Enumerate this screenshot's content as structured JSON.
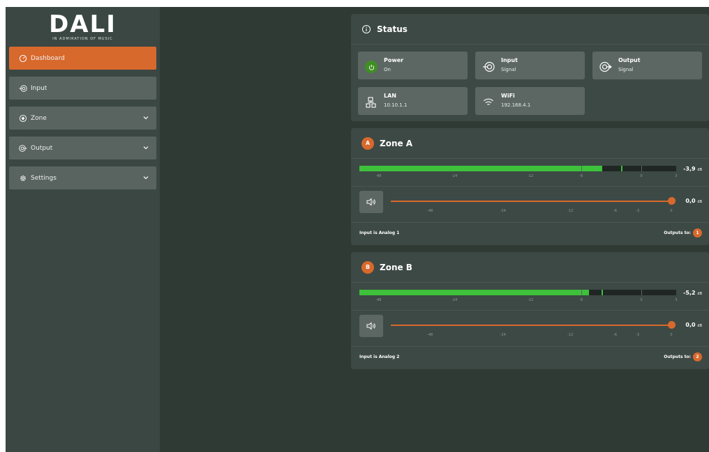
{
  "brand": {
    "name": "DALI",
    "tagline": "IN ADMIRATION OF MUSIC"
  },
  "colors": {
    "accent": "#d8692d",
    "meter_green": "#3ec13b",
    "power_green": "#3f8f23",
    "background": "#2f3a35",
    "sidebar": "#3a4743"
  },
  "sidebar": {
    "items": [
      {
        "label": "Dashboard",
        "icon": "dashboard-gauge-icon",
        "active": true,
        "expandable": false
      },
      {
        "label": "Input",
        "icon": "input-icon",
        "active": false,
        "expandable": false
      },
      {
        "label": "Zone",
        "icon": "zone-icon",
        "active": false,
        "expandable": true
      },
      {
        "label": "Output",
        "icon": "output-icon",
        "active": false,
        "expandable": true
      },
      {
        "label": "Settings",
        "icon": "gear-icon",
        "active": false,
        "expandable": true
      }
    ]
  },
  "status": {
    "title": "Status",
    "tiles": [
      {
        "name": "Power",
        "value": "On",
        "icon": "power-icon"
      },
      {
        "name": "Input",
        "value": "Signal",
        "icon": "input-icon"
      },
      {
        "name": "Output",
        "value": "Signal",
        "icon": "output-icon"
      },
      {
        "name": "LAN",
        "value": "10.10.1.1",
        "icon": "lan-icon"
      },
      {
        "name": "WiFi",
        "value": "192.168.4.1",
        "icon": "wifi-icon"
      }
    ]
  },
  "meter_ticks": [
    "-48",
    "-24",
    "-12",
    "-6",
    "0",
    "3"
  ],
  "volume_ticks": [
    "-48",
    "-24",
    "-12",
    "-6",
    "-3",
    "0"
  ],
  "zones": [
    {
      "badge": "A",
      "title": "Zone A",
      "meter_db": "-3,9",
      "meter_unit": "dB",
      "meter_level_db": -3.9,
      "meter_peak_db": -2,
      "volume_db": "0,0",
      "volume_unit": "dB",
      "volume_level": 1.0,
      "input_text": "Input is Analog 1",
      "outputs_label": "Outputs to:",
      "outputs_badge": "1"
    },
    {
      "badge": "B",
      "title": "Zone B",
      "meter_db": "-5,2",
      "meter_unit": "dB",
      "meter_level_db": -5.2,
      "meter_peak_db": -4,
      "volume_db": "0,0",
      "volume_unit": "dB",
      "volume_level": 1.0,
      "input_text": "Input is Analog 2",
      "outputs_label": "Outputs to:",
      "outputs_badge": "2"
    }
  ]
}
